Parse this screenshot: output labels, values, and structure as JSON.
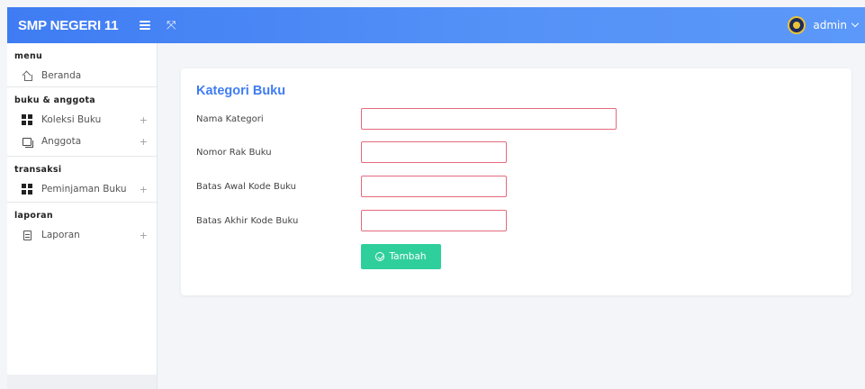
{
  "header": {
    "brand": "SMP NEGERI 11",
    "user_name": "admin"
  },
  "sidebar": {
    "sections": [
      {
        "title": "menu",
        "items": [
          {
            "label": "Beranda",
            "icon": "home-icon",
            "expandable": false
          }
        ]
      },
      {
        "title": "buku & anggota",
        "items": [
          {
            "label": "Koleksi Buku",
            "icon": "grid-icon",
            "expandable": true
          },
          {
            "label": "Anggota",
            "icon": "users-icon",
            "expandable": true
          }
        ]
      },
      {
        "title": "transaksi",
        "items": [
          {
            "label": "Peminjaman Buku",
            "icon": "grid-icon",
            "expandable": true
          }
        ]
      },
      {
        "title": "laporan",
        "items": [
          {
            "label": "Laporan",
            "icon": "report-icon",
            "expandable": true
          }
        ]
      }
    ],
    "expand_symbol": "+"
  },
  "form": {
    "title": "Kategori Buku",
    "fields": [
      {
        "label": "Nama Kategori",
        "value": ""
      },
      {
        "label": "Nomor Rak Buku",
        "value": ""
      },
      {
        "label": "Batas Awal Kode Buku",
        "value": ""
      },
      {
        "label": "Batas Akhir Kode Buku",
        "value": ""
      }
    ],
    "submit_label": "Tambah"
  },
  "colors": {
    "accent": "#3f7cf3",
    "submit_button": "#2fcf9c",
    "input_border": "#e46a7d"
  }
}
